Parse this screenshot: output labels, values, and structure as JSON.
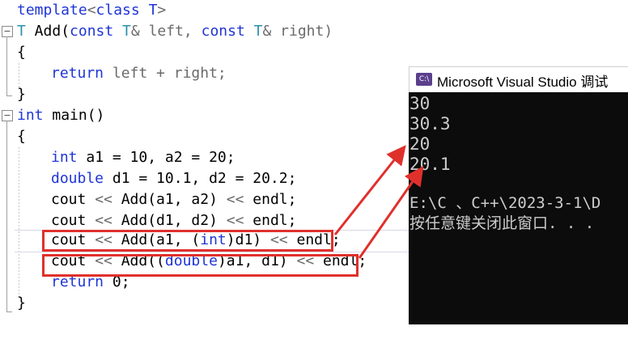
{
  "editor": {
    "line1": {
      "kw": "template",
      "sym": "<",
      "kw2": "class",
      "name": " T",
      "end": ">"
    },
    "line2": {
      "type": "T",
      "fn": " Add(",
      "kw": "const",
      "typ": " T",
      "rest": "& left, ",
      "kw2": "const",
      "typ2": " T",
      "rest2": "& right)"
    },
    "line3": "{",
    "line4": {
      "kw": "return",
      "rest": " left + right;"
    },
    "line5": "}",
    "line6": {
      "kw": "int",
      "rest": " main()"
    },
    "line7": "{",
    "line8": {
      "kw": "int",
      "rest": " a1 = 10, a2 = 20;"
    },
    "line9": {
      "kw": "double",
      "rest": " d1 = 10.1, d2 = 20.2;"
    },
    "line10": {
      "a": "cout ",
      "op": "<<",
      "b": " Add(a1, a2) ",
      "op2": "<<",
      "c": " endl;"
    },
    "line11": {
      "a": "cout ",
      "op": "<<",
      "b": " Add(d1, d2) ",
      "op2": "<<",
      "c": " endl;"
    },
    "line12": {
      "a": "cout ",
      "op": "<<",
      "b": " Add(a1, (",
      "kw": "int",
      "c": ")d1) ",
      "op2": "<<",
      "d": " endl;"
    },
    "line13": {
      "a": "cout ",
      "op": "<<",
      "b": " Add((",
      "kw": "double",
      "c": ")a1, d1) ",
      "op2": "<<",
      "d": " endl;"
    },
    "line14": {
      "kw": "return",
      "rest": " 0;"
    },
    "line15": "}",
    "fold_minus": "−"
  },
  "console": {
    "icon_label": "C:\\",
    "title": "Microsoft Visual Studio 调试",
    "lines": [
      "30",
      "30.3",
      "20",
      "20.1",
      "",
      "E:\\C 、C++\\2023-3-1\\D",
      "按任意键关闭此窗口. . ."
    ]
  },
  "colors": {
    "keyword": "#1f35d6",
    "type": "#2b91af",
    "operator": "#6b6b6b",
    "highlight": "#e0302c",
    "console_bg": "#0c0c0c",
    "console_text": "#cccccc"
  }
}
